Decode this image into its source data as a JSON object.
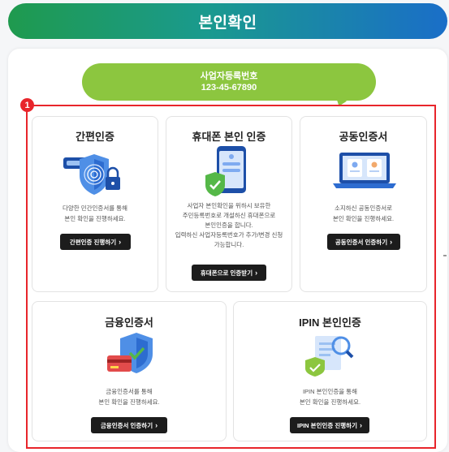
{
  "header": {
    "title": "본인확인"
  },
  "bubble": {
    "label": "사업자등록번호",
    "number": "123-45-67890"
  },
  "badge": {
    "number": "1"
  },
  "cards": {
    "simple": {
      "title": "간편인증",
      "desc": [
        "다양한 민간인증서를 통해",
        "본인 확인을 진행하세요."
      ],
      "button": "간편인증 진행하기"
    },
    "mobile": {
      "title": "휴대폰 본인 인증",
      "desc": [
        "사업자 본인확인을 위하시 보유한",
        "주민등록번호로 개설하신 휴대폰으로",
        "본인인증을 합니다.",
        "입력하신 사업자등록번호가 추가/변경 신청",
        "가능합니다."
      ],
      "button": "휴대폰으로 인증받기"
    },
    "joint": {
      "title": "공동인증서",
      "desc": [
        "소지하신 공동인증서로",
        "본인 확인을 진행하세요."
      ],
      "button": "공동인증서 인증하기"
    },
    "finance": {
      "title": "금융인증서",
      "desc": [
        "금융인증서를 통해",
        "본인 확인을 진행하세요."
      ],
      "button": "금융인증서 인증하기"
    },
    "ipin": {
      "title": "IPIN 본인인증",
      "desc": [
        "IPIN 본인인증을 통해",
        "본인 확인을 진행하세요."
      ],
      "button": "IPIN 본인인증 진행하기"
    }
  },
  "icons": {
    "chevron": "chevron-right-icon",
    "simple": "fingerprint-shield-icon",
    "mobile": "phone-shield-icon",
    "joint": "laptop-certificate-icon",
    "finance": "card-shield-icon",
    "ipin": "document-search-icon"
  },
  "colors": {
    "accent_green": "#8cc63f",
    "highlight_red": "#e8252b",
    "button": "#1c1c1c"
  }
}
